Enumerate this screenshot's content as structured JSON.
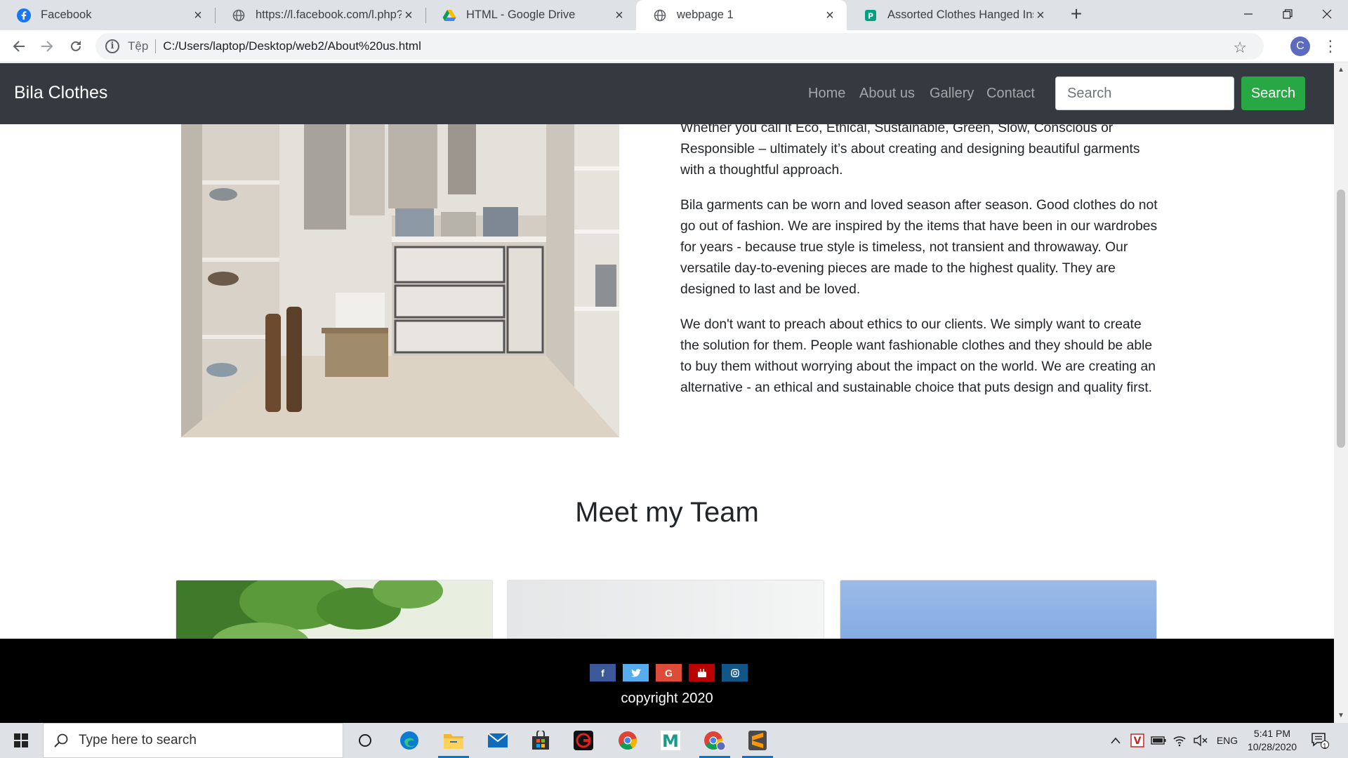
{
  "browser": {
    "tabs": [
      {
        "title": "Facebook",
        "icon": "facebook-icon"
      },
      {
        "title": "https://l.facebook.com/l.php?u=h",
        "icon": "globe-icon"
      },
      {
        "title": "HTML - Google Drive",
        "icon": "google-drive-icon"
      },
      {
        "title": "webpage 1",
        "icon": "globe-icon",
        "active": true
      },
      {
        "title": "Assorted Clothes Hanged Inside",
        "icon": "image-site-icon"
      }
    ],
    "scheme_label": "Tệp",
    "url": "C:/Users/laptop/Desktop/web2/About%20us.html",
    "profile_initial": "C"
  },
  "site": {
    "brand": "Bila Clothes",
    "nav": [
      "Home",
      "About us",
      "Gallery",
      "Contact"
    ],
    "search_placeholder": "Search",
    "search_button": "Search"
  },
  "about": {
    "paragraphs": [
      "Whether you call it Eco, Ethical, Sustainable, Green, Slow, Conscious or Responsible – ultimately it’s about creating and designing beautiful garments with a thoughtful approach.",
      "Bila garments can be worn and loved season after season. Good clothes do not go out of fashion. We are inspired by the items that have been in our wardrobes for years - because true style is timeless, not transient and throwaway. Our versatile day-to-evening pieces are made to the highest quality. They are designed to last and be loved.",
      "We don't want to preach about ethics to our clients. We simply want to create the solution for them. People want fashionable clothes and they should be able to buy them without worrying about the impact on the world. We are creating an alternative - an ethical and sustainable choice that puts design and quality first."
    ]
  },
  "team": {
    "heading": "Meet my Team"
  },
  "footer": {
    "social": [
      {
        "glyph": "f",
        "color": "#3b5998",
        "icon": "facebook-icon"
      },
      {
        "glyph": "t",
        "color": "#55acee",
        "icon": "twitter-icon"
      },
      {
        "glyph": "G",
        "color": "#dd4b39",
        "icon": "google-plus-icon"
      },
      {
        "glyph": "▶",
        "color": "#bb0000",
        "icon": "youtube-icon"
      },
      {
        "glyph": "◎",
        "color": "#125688",
        "icon": "instagram-icon"
      }
    ],
    "copyright": "copyright 2020"
  },
  "taskbar": {
    "search_placeholder": "Type here to search",
    "language": "ENG",
    "time": "5:41 PM",
    "date": "10/28/2020",
    "notification_count": "1"
  }
}
